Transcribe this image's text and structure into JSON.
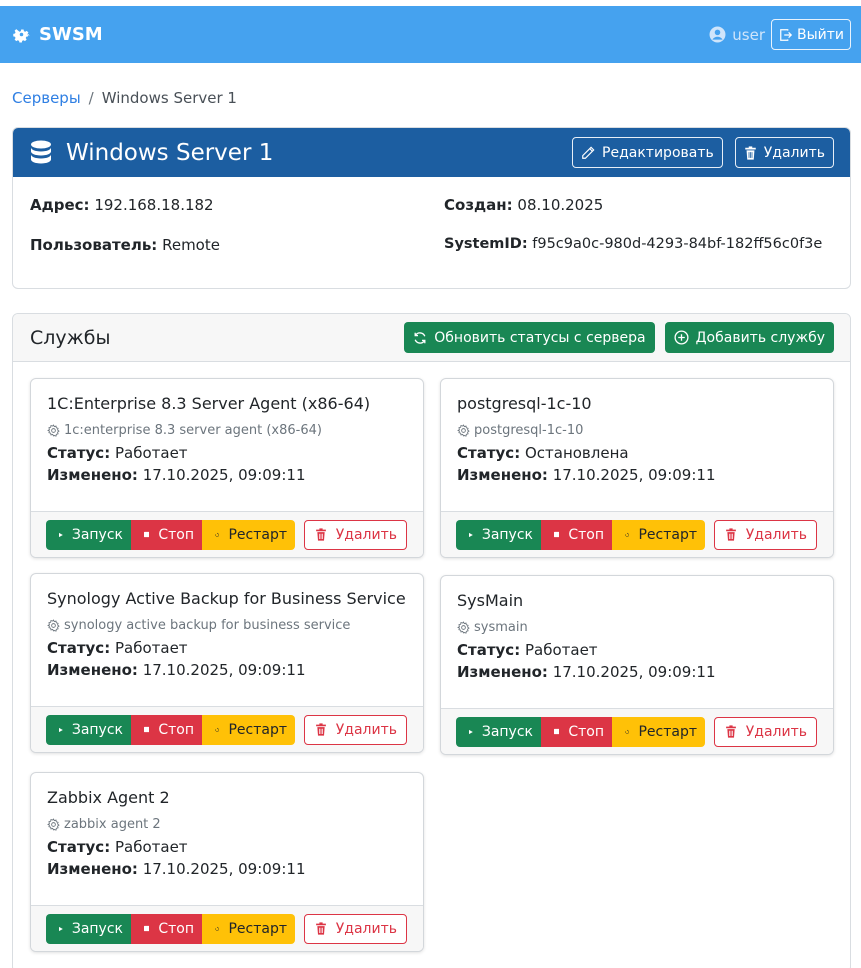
{
  "navbar": {
    "brand": "SWSM",
    "user": "user",
    "logout_label": "Выйти"
  },
  "breadcrumb": {
    "root": "Серверы",
    "separator": "/",
    "current": "Windows Server 1"
  },
  "server": {
    "title": "Windows Server 1",
    "edit_label": "Редактировать",
    "delete_label": "Удалить",
    "address_label": "Адрес:",
    "address": "192.168.18.182",
    "user_label": "Пользователь:",
    "user": "Remote",
    "created_label": "Создан:",
    "created": "08.10.2025",
    "systemid_label": "SystemID:",
    "systemid": "f95c9a0c-980d-4293-84bf-182ff56c0f3e"
  },
  "services": {
    "title": "Службы",
    "refresh_label": "Обновить статусы с сервера",
    "add_label": "Добавить службу",
    "labels": {
      "status": "Статус:",
      "changed": "Изменено:",
      "start": "Запуск",
      "stop": "Стоп",
      "restart": "Рестарт",
      "delete": "Удалить"
    },
    "items": [
      {
        "display_name": "1C:Enterprise 8.3 Server Agent (x86-64)",
        "system_name": "1c:enterprise 8.3 server agent (x86-64)",
        "status": "Работает",
        "changed": "17.10.2025, 09:09:11"
      },
      {
        "display_name": "postgresql-1c-10",
        "system_name": "postgresql-1c-10",
        "status": "Остановлена",
        "changed": "17.10.2025, 09:09:11"
      },
      {
        "display_name": "Synology Active Backup for Business Service",
        "system_name": "synology active backup for business service",
        "status": "Работает",
        "changed": "17.10.2025, 09:09:11"
      },
      {
        "display_name": "SysMain",
        "system_name": "sysmain",
        "status": "Работает",
        "changed": "17.10.2025, 09:09:11"
      },
      {
        "display_name": "Zabbix Agent 2",
        "system_name": "zabbix agent 2",
        "status": "Работает",
        "changed": "17.10.2025, 09:09:11"
      }
    ]
  },
  "colors": {
    "navbar": "#45a2ef",
    "server_header": "#1c5ea1",
    "success": "#198754",
    "danger": "#dc3545",
    "warning": "#ffc107",
    "link": "#2f7fe3"
  }
}
